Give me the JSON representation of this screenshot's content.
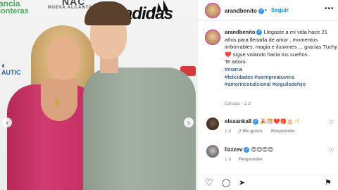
{
  "photo": {
    "backdrop": {
      "brand1_line1": "ancia",
      "brand1_line2": "ionteras",
      "brand2": "NAC",
      "brand2_sub": "NUEVA ALCANTARA",
      "brand3": "adidas",
      "brand4": "AUTIC"
    }
  },
  "header": {
    "username": "arandbenito",
    "verified_mark": "✓",
    "separator": "•",
    "follow_label": "Seguir",
    "more_label": "•••"
  },
  "caption": {
    "username": "arandbenito",
    "verified_mark": "✓",
    "text_1": "Llegaste a mi vida hace 21 años para llenarla de amor , momentos imborrables, magia e ilusiones ... gracias Tuchy",
    "heart": "❤️",
    "text_2": " sigue volando hacia tus sueños .",
    "text_3": "Te adoro.",
    "hashtag_1": "#mama",
    "hashtag_2": "#felicidades #siempreatuvera",
    "hashtag_3": "#amorincondicional #orgullodehijo",
    "meta": "Editado · 1 d"
  },
  "comments": [
    {
      "username": "elsaanka8",
      "verified_mark": "✓",
      "text": "🎉🎊❤️🎁🎂🥂",
      "time": "1 d",
      "likes": "2 Me gusta",
      "reply": "Responder"
    },
    {
      "username": "lizzzev",
      "verified_mark": "✓",
      "text": "😍😍😍😍",
      "time": "1 d",
      "reply": "Responder"
    }
  ],
  "nav": {
    "prev": "‹",
    "next": "›"
  },
  "icons": {
    "like": "♡",
    "comment": "◯",
    "share": "➤",
    "save": "⚑",
    "comment_like": "♡"
  },
  "colors": {
    "follow": "#0095f6",
    "verified": "#3897f0",
    "hashtag": "#00376b"
  }
}
